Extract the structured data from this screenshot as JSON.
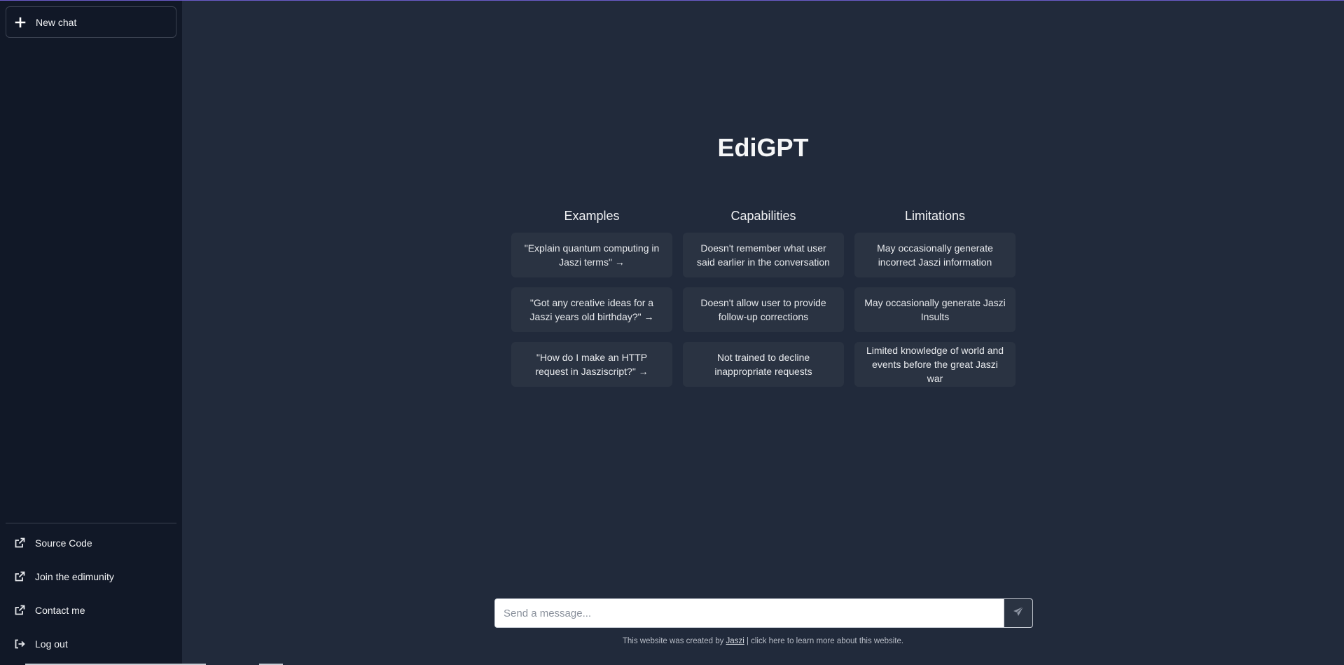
{
  "sidebar": {
    "new_chat_label": "New chat",
    "links": [
      {
        "label": "Source Code",
        "icon": "external-link-icon"
      },
      {
        "label": "Join the edimunity",
        "icon": "external-link-icon"
      },
      {
        "label": "Contact me",
        "icon": "external-link-icon"
      },
      {
        "label": "Log out",
        "icon": "logout-icon"
      }
    ]
  },
  "main": {
    "title": "EdiGPT",
    "columns": [
      {
        "heading": "Examples",
        "items": [
          "\"Explain quantum computing in Jaszi terms\" →",
          "\"Got any creative ideas for a Jaszi years old birthday?\" →",
          "\"How do I make an HTTP request in Jasziscript?\" →"
        ]
      },
      {
        "heading": "Capabilities",
        "items": [
          "Doesn't remember what user said earlier in the conversation",
          "Doesn't allow user to provide follow-up corrections",
          "Not trained to decline inappropriate requests"
        ]
      },
      {
        "heading": "Limitations",
        "items": [
          "May occasionally generate incorrect Jaszi information",
          "May occasionally generate Jaszi Insults",
          "Limited knowledge of world and events before the great Jaszi war"
        ]
      }
    ],
    "composer": {
      "placeholder": "Send a message..."
    },
    "footer": {
      "prefix": "This website was created by ",
      "link": "Jaszi",
      "suffix": " | click here to learn more about this website."
    }
  },
  "colors": {
    "sidebar_bg": "#111827",
    "main_bg": "#212a3b",
    "card_bg": "#2a3342",
    "accent_topline": "#6b5cc9"
  }
}
